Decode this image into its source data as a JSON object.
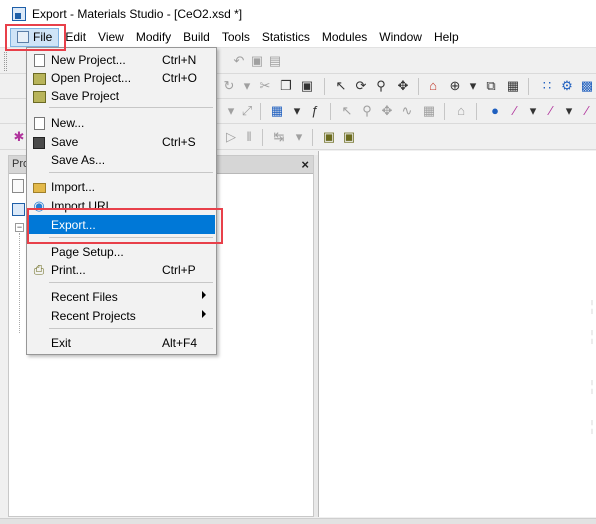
{
  "window": {
    "title": "Export - Materials Studio - [CeO2.xsd *]"
  },
  "menubar": {
    "items": [
      {
        "key": "file",
        "label": "File"
      },
      {
        "key": "edit",
        "label": "Edit"
      },
      {
        "key": "view",
        "label": "View"
      },
      {
        "key": "modify",
        "label": "Modify"
      },
      {
        "key": "build",
        "label": "Build"
      },
      {
        "key": "tools",
        "label": "Tools"
      },
      {
        "key": "statistics",
        "label": "Statistics"
      },
      {
        "key": "modules",
        "label": "Modules"
      },
      {
        "key": "window",
        "label": "Window"
      },
      {
        "key": "help",
        "label": "Help"
      }
    ]
  },
  "file_menu": {
    "new_project": {
      "label": "New Project...",
      "shortcut": "Ctrl+N"
    },
    "open_project": {
      "label": "Open Project...",
      "shortcut": "Ctrl+O"
    },
    "save_project": {
      "label": "Save Project"
    },
    "new": {
      "label": "New..."
    },
    "save": {
      "label": "Save",
      "shortcut": "Ctrl+S"
    },
    "save_as": {
      "label": "Save As..."
    },
    "import": {
      "label": "Import..."
    },
    "import_url": {
      "label": "Import URL..."
    },
    "export": {
      "label": "Export..."
    },
    "page_setup": {
      "label": "Page Setup..."
    },
    "print": {
      "label": "Print...",
      "shortcut": "Ctrl+P"
    },
    "recent_files": {
      "label": "Recent Files"
    },
    "recent_projects": {
      "label": "Recent Projects"
    },
    "exit": {
      "label": "Exit",
      "shortcut": "Alt+F4"
    }
  },
  "project_pane": {
    "title": "Pro"
  },
  "colors": {
    "highlight": "#0078d7",
    "annotation_red": "#e8404a"
  }
}
